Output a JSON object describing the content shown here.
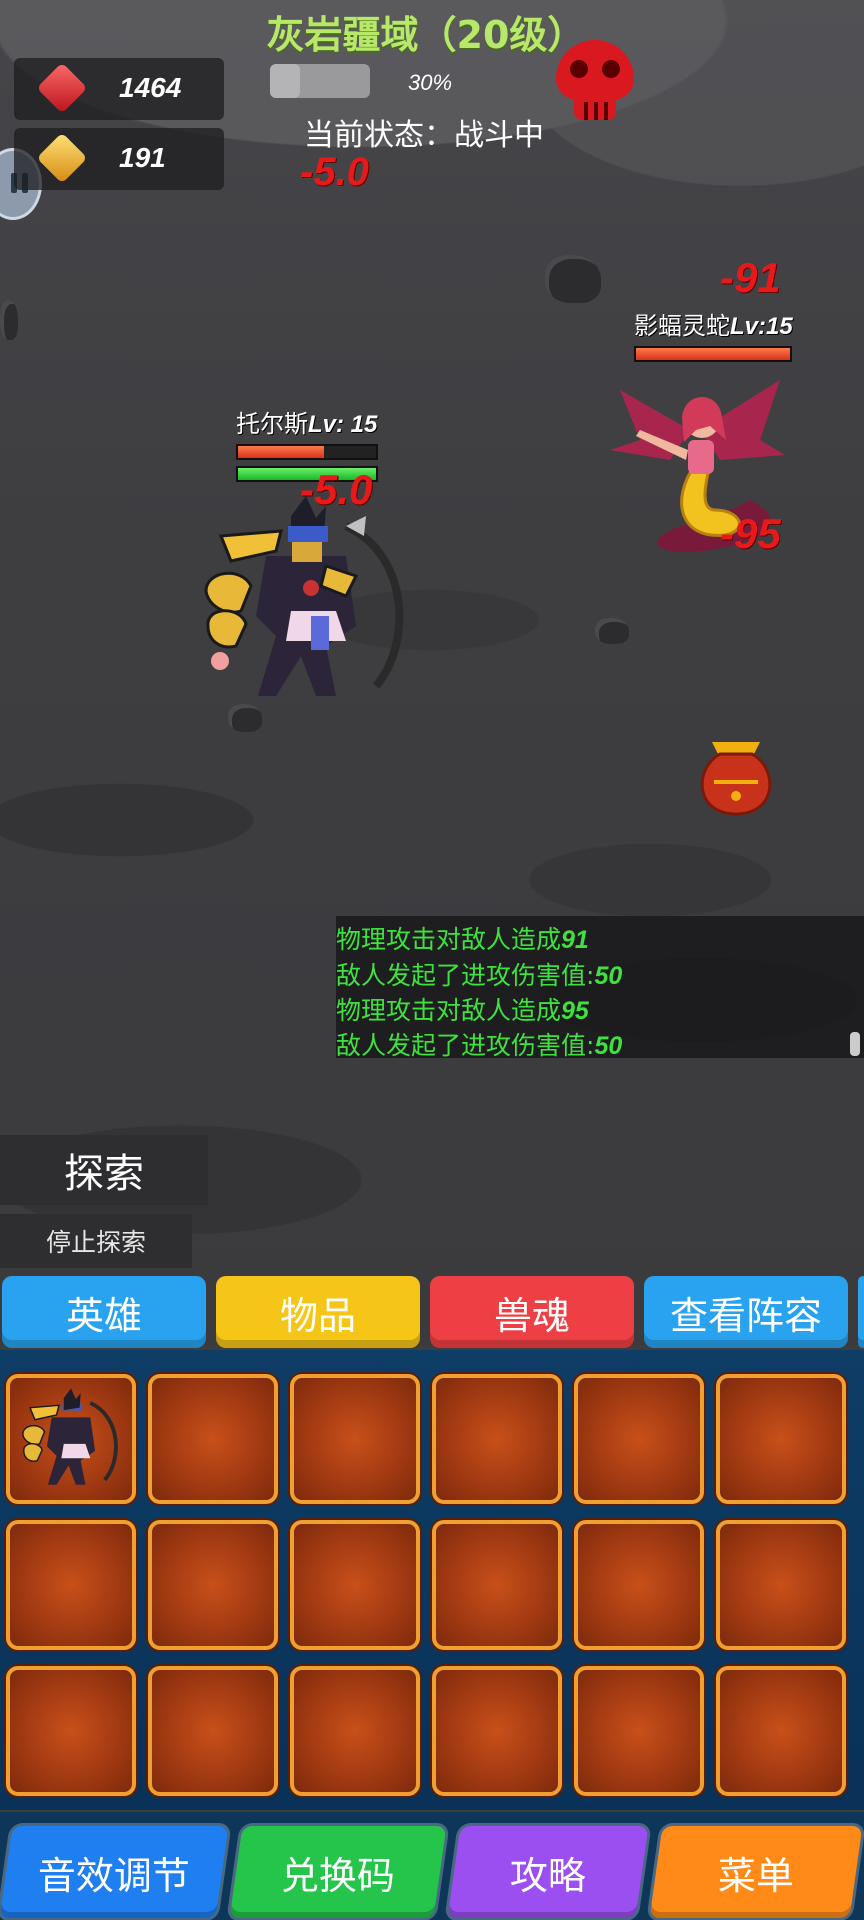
{
  "zone": {
    "title": "灰岩疆域（20级）",
    "progress_text": "30%",
    "progress": 0.3,
    "status": "当前状态：战斗中"
  },
  "currency": {
    "rubies": "1464",
    "gold": "191"
  },
  "damage": {
    "top_popup": "-5.0",
    "hero_popup": "-5.0",
    "enemy_popup_1": "-91",
    "enemy_popup_2": "-95"
  },
  "hero": {
    "name": "托尔斯",
    "level": "Lv: 15",
    "hp_fraction": 0.62,
    "mp_fraction": 1.0
  },
  "enemy": {
    "name": "影蝠灵蛇",
    "level": "Lv:15",
    "hp_fraction": 1.0
  },
  "combat_log": [
    {
      "text": "物理攻击对敌人造成",
      "num": "91"
    },
    {
      "text": "敌人发起了进攻伤害值:",
      "num": "50"
    },
    {
      "text": "物理攻击对敌人造成",
      "num": "95"
    },
    {
      "text": "敌人发起了进攻伤害值:",
      "num": "50"
    }
  ],
  "actions": {
    "explore": "探索",
    "stop_explore": "停止探索"
  },
  "tabs": [
    {
      "label": "英雄",
      "color": "#29a3f0"
    },
    {
      "label": "物品",
      "color": "#f5c518"
    },
    {
      "label": "兽魂",
      "color": "#ee4044"
    },
    {
      "label": "查看阵容",
      "color": "#29a3f0"
    }
  ],
  "bottom_menu": [
    {
      "label": "音效调节",
      "color": "#1f7ef0"
    },
    {
      "label": "兑换码",
      "color": "#25c44a"
    },
    {
      "label": "攻略",
      "color": "#9c4ff0"
    },
    {
      "label": "菜单",
      "color": "#ff8a17"
    }
  ],
  "colors": {
    "title_green": "#b8e86a",
    "log_green": "#3ee23e",
    "damage_red": "#e8191a",
    "slot_orange": "#c8501a",
    "slot_border": "#f0a030"
  }
}
